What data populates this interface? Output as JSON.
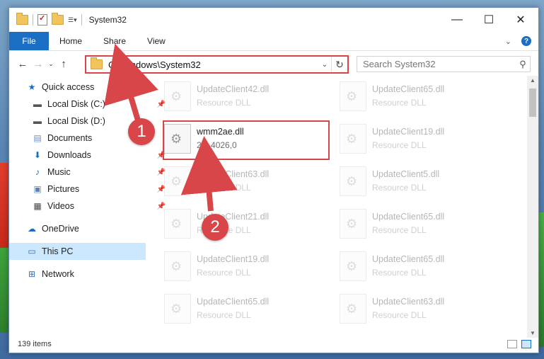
{
  "window": {
    "title": "System32",
    "controls": [
      "—",
      "☐",
      "✕"
    ]
  },
  "ribbon": {
    "tabs": [
      "File",
      "Home",
      "Share",
      "View"
    ]
  },
  "nav": {
    "address": "C:\\Windows\\System32",
    "search_placeholder": "Search System32"
  },
  "sidebar": {
    "items": [
      {
        "label": "Quick access",
        "icon": "star-icon"
      },
      {
        "label": "Local Disk (C:)",
        "icon": "drive-icon"
      },
      {
        "label": "Local Disk (D:)",
        "icon": "drive-icon"
      },
      {
        "label": "Documents",
        "icon": "documents-icon"
      },
      {
        "label": "Downloads",
        "icon": "downloads-icon"
      },
      {
        "label": "Music",
        "icon": "music-icon"
      },
      {
        "label": "Pictures",
        "icon": "pictures-icon"
      },
      {
        "label": "Videos",
        "icon": "videos-icon"
      },
      {
        "label": "OneDrive",
        "icon": "cloud-icon"
      },
      {
        "label": "This PC",
        "icon": "computer-icon"
      },
      {
        "label": "Network",
        "icon": "network-icon"
      }
    ]
  },
  "files": {
    "col1": [
      {
        "name": "UpdateClient42.dll",
        "type": "Resource DLL"
      },
      {
        "name": "wmm2ae.dll",
        "type": "2,1,4026,0"
      },
      {
        "name": "UpdateClient63.dll",
        "type": "Resource DLL"
      },
      {
        "name": "UpdateClient21.dll",
        "type": "Resource DLL"
      },
      {
        "name": "UpdateClient19.dll",
        "type": "Resource DLL"
      },
      {
        "name": "UpdateClient65.dll",
        "type": "Resource DLL"
      }
    ],
    "col2": [
      {
        "name": "UpdateClient65.dll",
        "type": "Resource DLL"
      },
      {
        "name": "UpdateClient19.dll",
        "type": "Resource DLL"
      },
      {
        "name": "UpdateClient5.dll",
        "type": "Resource DLL"
      },
      {
        "name": "UpdateClient65.dll",
        "type": "Resource DLL"
      },
      {
        "name": "UpdateClient65.dll",
        "type": "Resource DLL"
      },
      {
        "name": "UpdateClient63.dll",
        "type": "Resource DLL"
      }
    ]
  },
  "status": {
    "count": "139 items"
  },
  "annotations": {
    "step1": "1",
    "step2": "2",
    "color": "#d8464a"
  }
}
